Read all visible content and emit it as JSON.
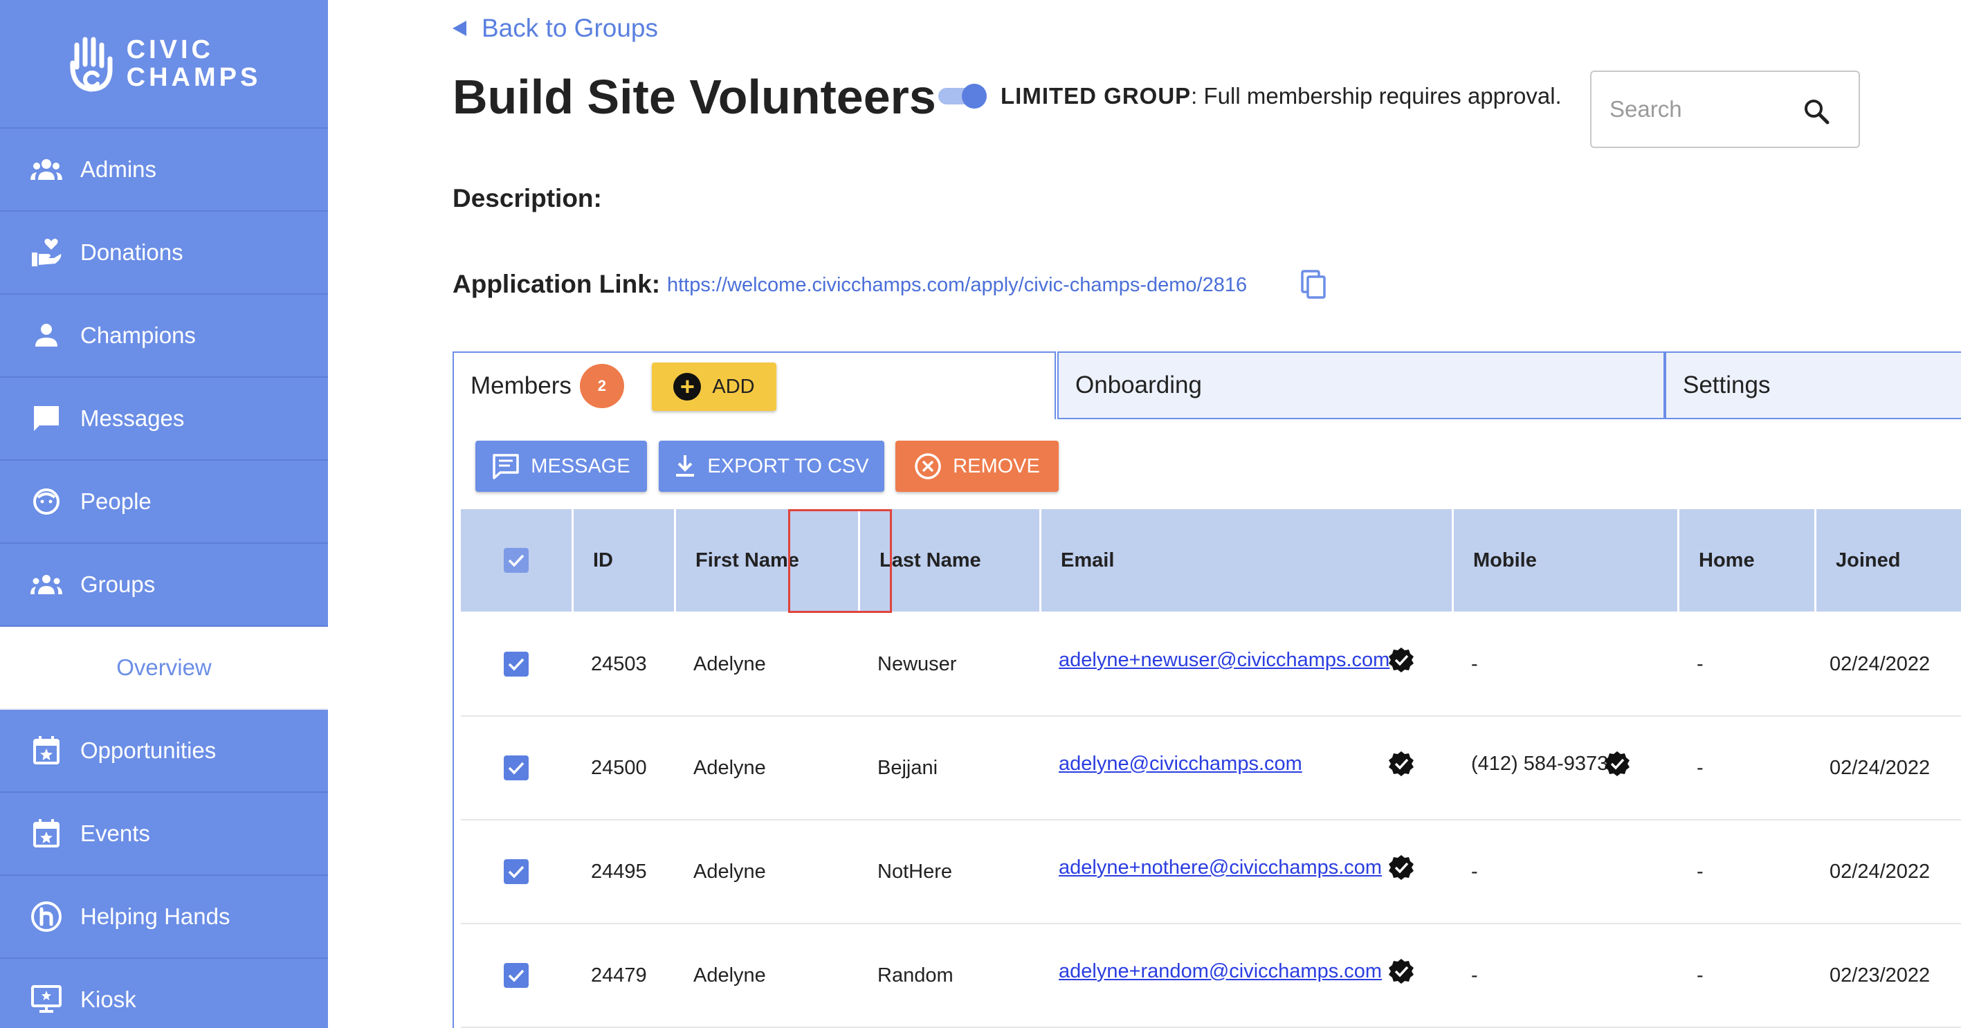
{
  "brand": {
    "line1": "CIVIC",
    "line2": "CHAMPS"
  },
  "sidebar": {
    "items": [
      {
        "label": "Admins",
        "icon": "people-group-icon"
      },
      {
        "label": "Donations",
        "icon": "donation-hand-heart-icon"
      },
      {
        "label": "Champions",
        "icon": "person-icon"
      },
      {
        "label": "Messages",
        "icon": "chat-bubble-icon"
      },
      {
        "label": "People",
        "icon": "face-icon"
      },
      {
        "label": "Groups",
        "icon": "groups-icon"
      },
      {
        "label": "Overview",
        "icon": ""
      },
      {
        "label": "Opportunities",
        "icon": "calendar-star-icon"
      },
      {
        "label": "Events",
        "icon": "calendar-star-icon"
      },
      {
        "label": "Helping Hands",
        "icon": "helping-hands-icon"
      },
      {
        "label": "Kiosk",
        "icon": "monitor-star-icon"
      }
    ],
    "active": "Overview"
  },
  "header": {
    "back_label": "Back to Groups",
    "title": "Build Site Volunteers",
    "toggle_on": true,
    "limited_bold": "LIMITED GROUP",
    "limited_rest": ": Full membership requires approval.",
    "search_placeholder": "Search"
  },
  "description": {
    "label": "Description:"
  },
  "application": {
    "label": "Application Link:",
    "url": "https://welcome.civicchamps.com/apply/civic-champs-demo/2816"
  },
  "tabs": {
    "members": {
      "label": "Members",
      "count": "2"
    },
    "add_label": "ADD",
    "onboarding": "Onboarding",
    "settings": "Settings"
  },
  "actions": {
    "message": "MESSAGE",
    "export": "EXPORT TO CSV",
    "remove": "REMOVE"
  },
  "table": {
    "columns": [
      "ID",
      "First Name",
      "Last Name",
      "Email",
      "Mobile",
      "Home",
      "Joined"
    ],
    "rows": [
      {
        "id": "24503",
        "first": "Adelyne",
        "last": "Newuser",
        "email": "adelyne+newuser@civicchamps.com",
        "mobile": "-",
        "mobile_verified": false,
        "home": "-",
        "joined": "02/24/2022"
      },
      {
        "id": "24500",
        "first": "Adelyne",
        "last": "Bejjani",
        "email": "adelyne@civicchamps.com",
        "mobile": "(412) 584-9373",
        "mobile_verified": true,
        "home": "-",
        "joined": "02/24/2022"
      },
      {
        "id": "24495",
        "first": "Adelyne",
        "last": "NotHere",
        "email": "adelyne+nothere@civicchamps.com",
        "mobile": "-",
        "mobile_verified": false,
        "home": "-",
        "joined": "02/24/2022"
      },
      {
        "id": "24479",
        "first": "Adelyne",
        "last": "Random",
        "email": "adelyne+random@civicchamps.com",
        "mobile": "-",
        "mobile_verified": false,
        "home": "-",
        "joined": "02/23/2022"
      }
    ]
  },
  "colors": {
    "sidebar": "#6b8ee6",
    "accent": "#5a7fe0",
    "table_header": "#bfcfee",
    "add_button": "#f5c842",
    "remove_button": "#ee7b4b",
    "badge": "#ee7b4b"
  }
}
